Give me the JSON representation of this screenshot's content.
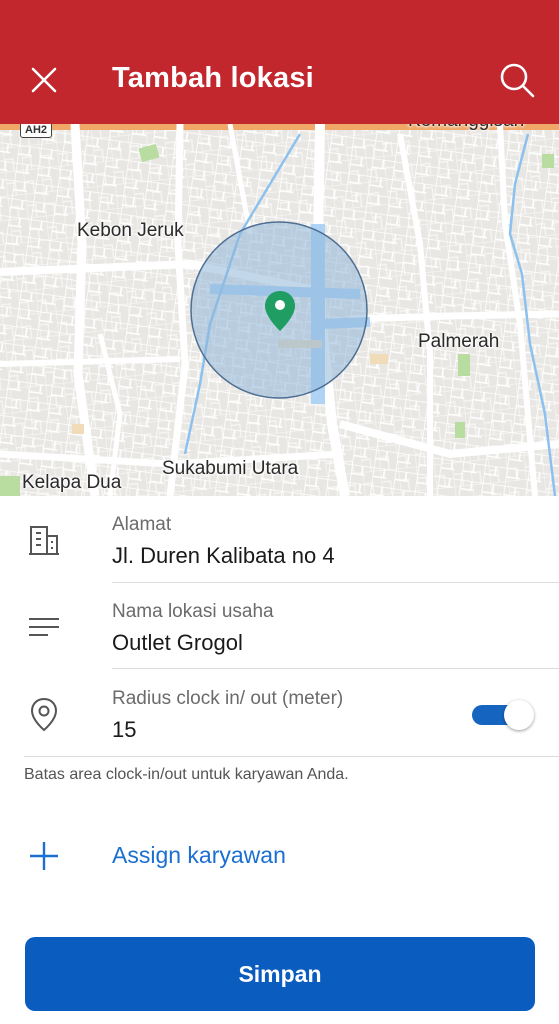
{
  "header": {
    "title": "Tambah lokasi",
    "color": "#c1272d"
  },
  "map": {
    "labels": {
      "kemanggisan": "Kemanggisan",
      "kebon_jeruk": "Kebon Jeruk",
      "palmerah": "Palmerah",
      "sukabumi_utara": "Sukabumi Utara",
      "kelapa_dua": "Kelapa Dua",
      "ah2": "AH2"
    },
    "pin_color": "#1f9d63"
  },
  "form": {
    "address": {
      "label": "Alamat",
      "value": "Jl. Duren Kalibata no 4",
      "icon": "building-icon"
    },
    "location_name": {
      "label": "Nama lokasi usaha",
      "value": "Outlet Grogol",
      "icon": "notes-icon"
    },
    "radius": {
      "label": "Radius clock in/ out (meter)",
      "value": "15",
      "icon": "location-pin-icon",
      "toggle_on": true
    },
    "helper": "Batas area clock-in/out untuk karyawan Anda."
  },
  "assign": {
    "label": "Assign karyawan",
    "color": "#1a6fd1"
  },
  "save": {
    "label": "Simpan",
    "color": "#0b5cbf"
  }
}
